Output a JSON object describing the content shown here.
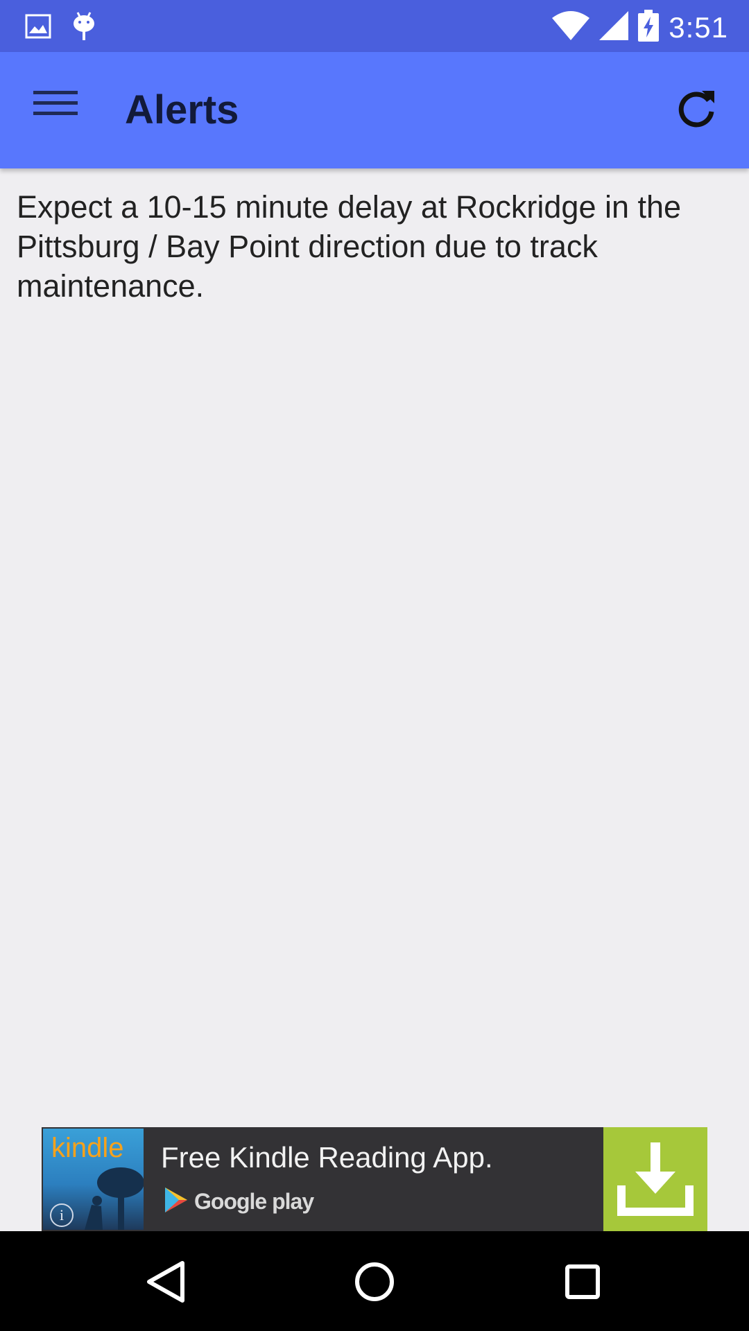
{
  "status_bar": {
    "time": "3:51",
    "icons": [
      "image-notification-icon",
      "android-notification-icon",
      "wifi-icon",
      "cell-signal-icon",
      "battery-charging-icon"
    ]
  },
  "app_bar": {
    "title": "Alerts",
    "menu_icon": "hamburger-menu-icon",
    "refresh_icon": "refresh-icon"
  },
  "content": {
    "alert_message": "Expect a 10-15 minute delay at Rockridge in the Pittsburg / Bay Point direction due to track maintenance."
  },
  "ad": {
    "logo_text": "kindle",
    "headline": "Free Kindle Reading App.",
    "store_label": "Google play",
    "info_label": "i",
    "download_icon": "download-icon"
  },
  "colors": {
    "status_bar": "#4a5fdd",
    "app_bar": "#5877fd",
    "background": "#efeef1",
    "ad_background": "#333235",
    "ad_download": "#a6c83a",
    "kindle_orange": "#f7a21b"
  },
  "nav_bar": {
    "icons": [
      "back-icon",
      "home-icon",
      "recents-icon"
    ]
  }
}
